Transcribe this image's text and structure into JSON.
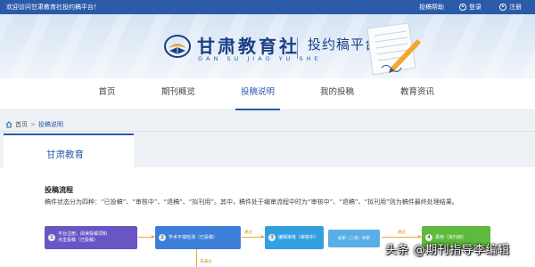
{
  "topbar": {
    "welcome": "欢迎访问甘肃教育社投约稿平台！",
    "links": [
      {
        "label": "投稿帮助",
        "icon": "help-icon"
      },
      {
        "label": "登录",
        "icon": "user-icon"
      },
      {
        "label": "注册",
        "icon": "register-icon"
      }
    ]
  },
  "banner": {
    "logo_cn": "甘肃教育社",
    "logo_en": "GAN SU JIAO YU SHE",
    "platform_title": "投约稿平台"
  },
  "nav": {
    "items": [
      {
        "label": "首页",
        "active": false
      },
      {
        "label": "期刊概览",
        "active": false
      },
      {
        "label": "投稿说明",
        "active": true
      },
      {
        "label": "我的投稿",
        "active": false
      },
      {
        "label": "教育资讯",
        "active": false
      }
    ]
  },
  "breadcrumb": {
    "home": "首页",
    "separator": ">",
    "current": "投稿说明"
  },
  "panel": {
    "tab": "甘肃教育",
    "section_title": "投稿流程",
    "description": "稿件状态分为四种：“已投稿”、“审核中”、“退稿”、“拟刊用”。其中，稿件处于编审流程中时为“审核中”、“退稿”、“拟刊用”则为稿件最终处理结果。",
    "flow": {
      "steps": [
        {
          "num": "1",
          "line1": "平台注册，阅读投稿须知",
          "line2": "点击投稿（已投稿）",
          "color": "#6a55c4"
        },
        {
          "num": "2",
          "line1": "学术不端检测（已投稿）",
          "line2": "",
          "color": "#3b7fd8"
        },
        {
          "num": "3",
          "line1": "编辑审核（审核中）",
          "line2": "",
          "color": "#35a0e0"
        },
        {
          "num": "4",
          "line1": "录用（拟刊用）",
          "line2": "",
          "color": "#5dba3c"
        }
      ],
      "arrow_labels": [
        "通过",
        "通过"
      ],
      "sub_box": "初审（二审）终审",
      "down_label": "未通过"
    }
  },
  "watermark": "头条 @期刊指导李编辑",
  "colors": {
    "primary": "#2a5aa8",
    "topbar": "#2a5aa8",
    "arrow": "#f0a830"
  }
}
